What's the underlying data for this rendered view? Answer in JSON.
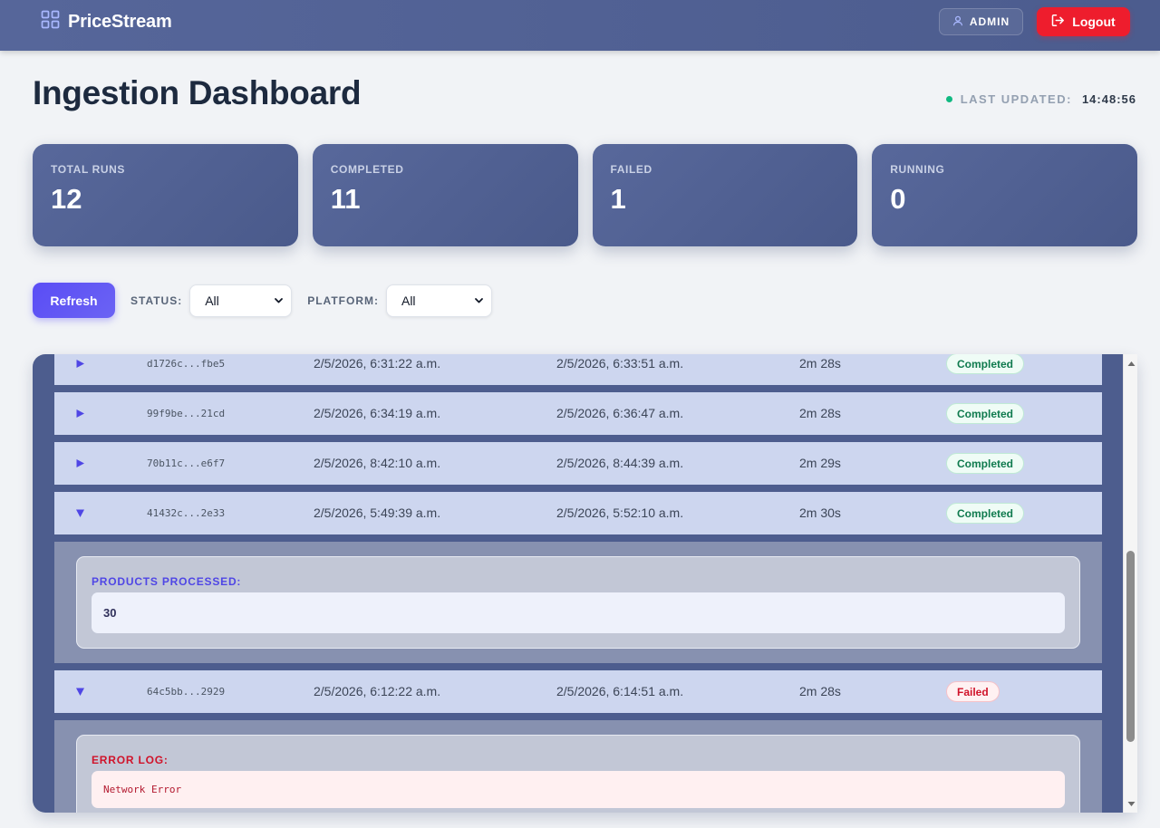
{
  "header": {
    "brand": "PriceStream",
    "user_label": "ADMIN",
    "logout_label": "Logout"
  },
  "page": {
    "title": "Ingestion Dashboard",
    "last_updated_label": "LAST UPDATED:",
    "last_updated_time": "14:48:56"
  },
  "stats": [
    {
      "label": "TOTAL RUNS",
      "value": "12"
    },
    {
      "label": "COMPLETED",
      "value": "11"
    },
    {
      "label": "FAILED",
      "value": "1"
    },
    {
      "label": "RUNNING",
      "value": "0"
    }
  ],
  "controls": {
    "refresh_label": "Refresh",
    "status_label": "STATUS:",
    "status_value": "All",
    "platform_label": "PLATFORM:",
    "platform_value": "All"
  },
  "runs": [
    {
      "id": "d1726c...fbe5",
      "started": "2/5/2026, 6:31:22 a.m.",
      "ended": "2/5/2026, 6:33:51 a.m.",
      "duration": "2m 28s",
      "status": "Completed",
      "expanded": false
    },
    {
      "id": "99f9be...21cd",
      "started": "2/5/2026, 6:34:19 a.m.",
      "ended": "2/5/2026, 6:36:47 a.m.",
      "duration": "2m 28s",
      "status": "Completed",
      "expanded": false
    },
    {
      "id": "70b11c...e6f7",
      "started": "2/5/2026, 8:42:10 a.m.",
      "ended": "2/5/2026, 8:44:39 a.m.",
      "duration": "2m 29s",
      "status": "Completed",
      "expanded": false
    },
    {
      "id": "41432c...2e33",
      "started": "2/5/2026, 5:49:39 a.m.",
      "ended": "2/5/2026, 5:52:10 a.m.",
      "duration": "2m 30s",
      "status": "Completed",
      "expanded": true,
      "detail": {
        "label": "PRODUCTS PROCESSED:",
        "value": "30"
      }
    },
    {
      "id": "64c5bb...2929",
      "started": "2/5/2026, 6:12:22 a.m.",
      "ended": "2/5/2026, 6:14:51 a.m.",
      "duration": "2m 28s",
      "status": "Failed",
      "expanded": true,
      "detail": {
        "label": "ERROR LOG:",
        "value": "Network Error"
      }
    }
  ],
  "colors": {
    "header_bg": "#56669a",
    "accent": "#5a4df5",
    "danger": "#ee1d2d",
    "success": "#10b981"
  },
  "icons": {
    "brand": "grid-icon",
    "user": "user-icon",
    "logout": "logout-icon",
    "toggle_collapsed": "triangle-right-icon",
    "toggle_expanded": "triangle-down-icon",
    "select": "chevron-down-icon"
  }
}
